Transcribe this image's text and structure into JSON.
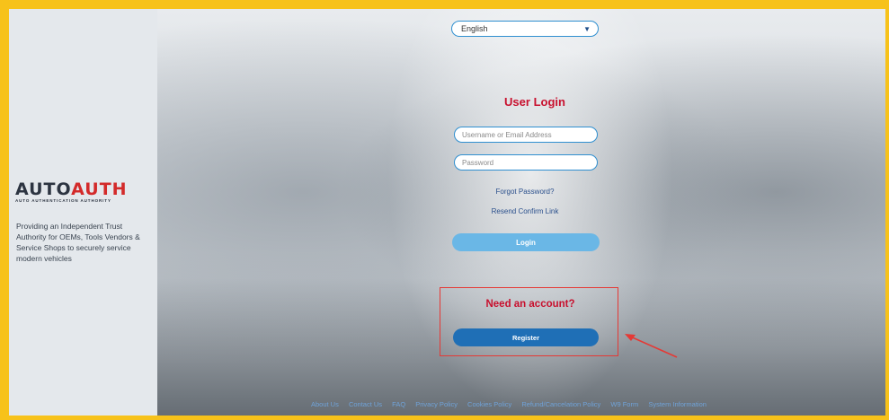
{
  "language": {
    "selected": "English"
  },
  "login": {
    "title": "User Login",
    "username_placeholder": "Username or Email Address",
    "password_placeholder": "Password",
    "forgot_password": "Forgot Password?",
    "resend_confirm": "Resend Confirm Link",
    "login_label": "Login"
  },
  "register": {
    "heading": "Need an account?",
    "button_label": "Register"
  },
  "brand": {
    "logo_prefix": "AUTO",
    "logo_suffix": "AUTH",
    "logo_subtitle": "AUTO AUTHENTICATION AUTHORITY",
    "tagline": "Providing an Independent Trust Authority for OEMs, Tools Vendors & Service Shops to securely service modern vehicles"
  },
  "footer": {
    "links": [
      "About Us",
      "Contact Us",
      "FAQ",
      "Privacy Policy",
      "Cookies Policy",
      "Refund/Cancelation Policy",
      "W9 Form",
      "System Information"
    ]
  },
  "colors": {
    "frame": "#f7c21a",
    "accent_red": "#c8102e",
    "primary_blue": "#1f6fb6",
    "login_blue": "#6ab7e6"
  }
}
